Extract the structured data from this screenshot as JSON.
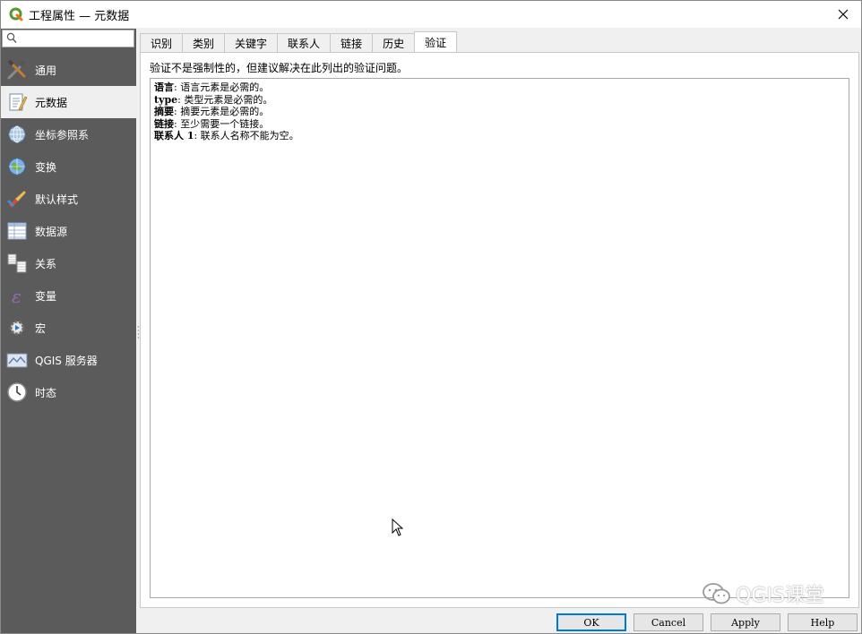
{
  "window": {
    "title": "工程属性 — 元数据"
  },
  "search": {
    "placeholder": "",
    "value": ""
  },
  "sidebar": {
    "items": [
      {
        "label": "通用",
        "icon": "tools-icon"
      },
      {
        "label": "元数据",
        "icon": "metadata-icon",
        "active": true
      },
      {
        "label": "坐标参照系",
        "icon": "globe-grid-icon"
      },
      {
        "label": "变换",
        "icon": "globe-transform-icon"
      },
      {
        "label": "默认样式",
        "icon": "paintbrush-icon"
      },
      {
        "label": "数据源",
        "icon": "table-icon"
      },
      {
        "label": "关系",
        "icon": "relations-icon"
      },
      {
        "label": "变量",
        "icon": "variable-icon"
      },
      {
        "label": "宏",
        "icon": "gear-play-icon"
      },
      {
        "label": "QGIS 服务器",
        "icon": "map-server-icon"
      },
      {
        "label": "时态",
        "icon": "clock-icon"
      }
    ]
  },
  "tabs": [
    {
      "label": "识别"
    },
    {
      "label": "类别"
    },
    {
      "label": "关键字"
    },
    {
      "label": "联系人"
    },
    {
      "label": "链接"
    },
    {
      "label": "历史"
    },
    {
      "label": "验证",
      "active": true
    }
  ],
  "validation": {
    "description": "验证不是强制性的，但建议解决在此列出的验证问题。",
    "results": [
      {
        "field": "语言",
        "message": ": 语言元素是必需的。"
      },
      {
        "field": "type",
        "message": ": 类型元素是必需的。"
      },
      {
        "field": "摘要",
        "message": ": 摘要元素是必需的。"
      },
      {
        "field": "链接",
        "message": ": 至少需要一个链接。"
      },
      {
        "field": "联系人 1",
        "message": ": 联系人名称不能为空。"
      }
    ]
  },
  "buttons": {
    "ok": "OK",
    "cancel": "Cancel",
    "apply": "Apply",
    "help": "Help"
  },
  "watermark": {
    "text": "QGIS课堂"
  },
  "colors": {
    "sidebar_bg": "#5b5b5b",
    "accent": "#0078d7",
    "qgis_green": "#589632"
  }
}
